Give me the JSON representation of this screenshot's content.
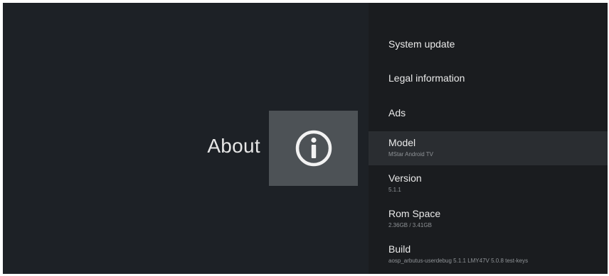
{
  "page": {
    "title": "About"
  },
  "menu": {
    "items": [
      {
        "label": "System update"
      },
      {
        "label": "Legal information"
      },
      {
        "label": "Ads"
      },
      {
        "label": "Model",
        "value": "MStar Android TV",
        "selected": true
      },
      {
        "label": "Version",
        "value": "5.1.1"
      },
      {
        "label": "Rom Space",
        "value": "2.36GB / 3.41GB"
      },
      {
        "label": "Build",
        "value": "aosp_arbutus-userdebug 5.1.1 LMY47V 5.0.8 test-keys"
      }
    ]
  },
  "icons": {
    "section_icon": "info-icon"
  },
  "colors": {
    "background_left": "#1d2126",
    "background_right": "#1a1c1f",
    "selected_row": "#2a2d31",
    "icon_tile": "#4d5256",
    "primary_text": "#eaeaea",
    "secondary_text": "#8f9397"
  }
}
